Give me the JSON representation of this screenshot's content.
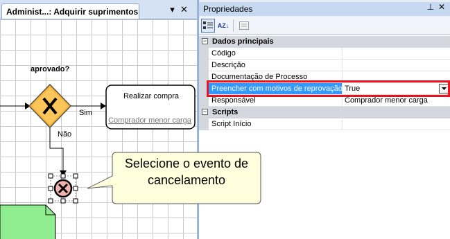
{
  "document_tab": {
    "title": "Administ...: Adquirir suprimentos",
    "pin_icon": "dropdown-pin-icon",
    "close_icon": "close-icon"
  },
  "diagram": {
    "gateway_label": "aprovado?",
    "gateway_icon": "x-gateway-icon",
    "flow_yes": "Sim",
    "flow_no": "Não",
    "task_title": "Realizar compra",
    "task_assignee": "Comprador menor carga",
    "cancel_event_icon": "cancel-event-icon"
  },
  "callout": {
    "line1": "Selecione o evento de",
    "line2": "cancelamento"
  },
  "properties": {
    "title": "Propriedades",
    "pin_icon": "pin-icon",
    "close_icon": "close-icon",
    "toolbar": {
      "categorized_icon": "categorized-icon",
      "alphabetical_icon": "alphabetical-icon",
      "alphabetical_label": "AZ",
      "pages_icon": "property-pages-icon"
    },
    "categories": [
      {
        "name": "Dados principais",
        "rows": [
          {
            "name": "Código",
            "value": ""
          },
          {
            "name": "Descrição",
            "value": ""
          },
          {
            "name": "Documentação de Processo",
            "value": ""
          },
          {
            "name": "Preencher com motivos de reprovação",
            "value": "True"
          },
          {
            "name": "Responsável",
            "value": "Comprador menor carga"
          }
        ]
      },
      {
        "name": "Scripts",
        "rows": [
          {
            "name": "Script Início",
            "value": ""
          }
        ]
      }
    ],
    "expander_symbol": "−"
  }
}
